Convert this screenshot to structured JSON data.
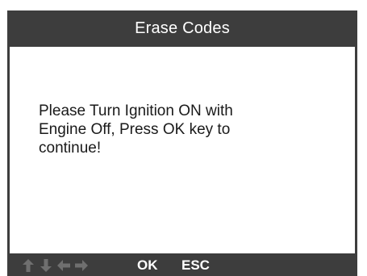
{
  "header": {
    "title": "Erase Codes"
  },
  "message": {
    "text": "    Please Turn Ignition ON with\nEngine Off, Press OK key to\ncontinue!"
  },
  "footer": {
    "arrow_icons": [
      "arrow-up-icon",
      "arrow-down-icon",
      "arrow-left-icon",
      "arrow-right-icon"
    ],
    "ok_label": "OK",
    "esc_label": "ESC"
  },
  "colors": {
    "frame": "#3d3d3d",
    "content_background": "#ffffff",
    "title_text": "#ffffff",
    "message_text": "#1a1a1a",
    "arrow_icons": "#6f6f6f"
  }
}
